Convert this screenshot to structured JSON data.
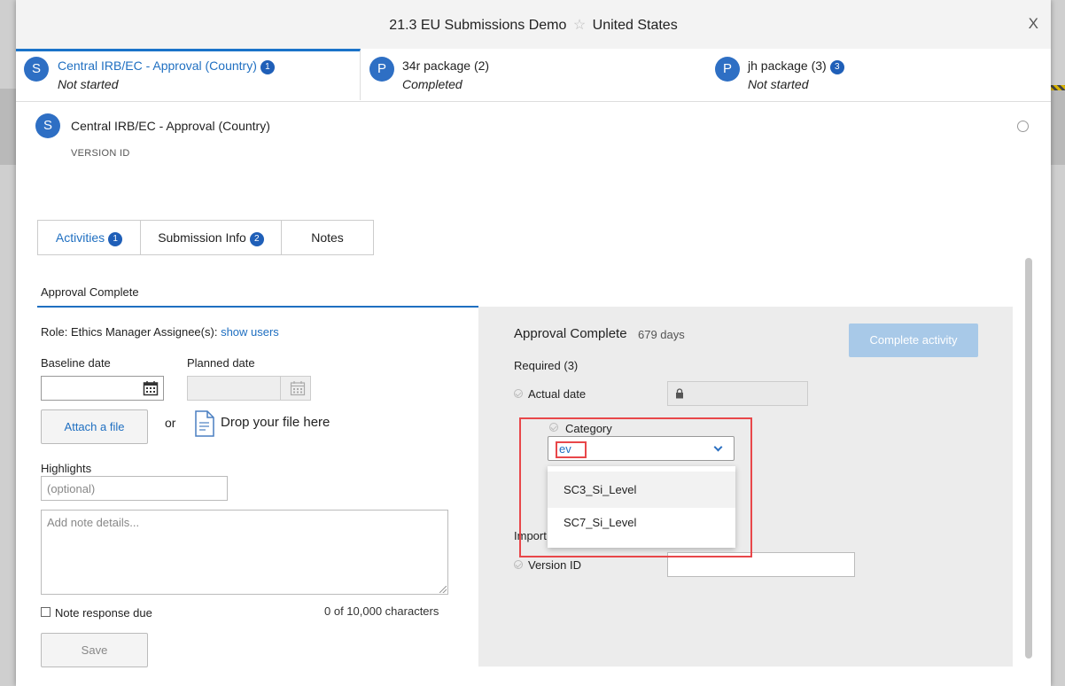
{
  "modal": {
    "title": "21.3 EU Submissions Demo",
    "country": "United States",
    "close_label": "X"
  },
  "package_tabs": [
    {
      "avatar": "S",
      "name": "Central IRB/EC - Approval (Country)",
      "badge": "1",
      "status": "Not started",
      "active": true
    },
    {
      "avatar": "P",
      "name": "34r package (2)",
      "badge": "",
      "status": "Completed",
      "active": false
    },
    {
      "avatar": "P",
      "name": "jh package (3)",
      "badge": "3",
      "status": "Not started",
      "active": false
    }
  ],
  "submission": {
    "avatar": "S",
    "title": "Central IRB/EC - Approval (Country)",
    "version_label": "VERSION ID"
  },
  "activity_tabs": [
    {
      "label": "Activities",
      "badge": "1",
      "active": true
    },
    {
      "label": "Submission Info",
      "badge": "2",
      "active": false
    },
    {
      "label": "Notes",
      "badge": "",
      "active": false
    }
  ],
  "step_tab": "Approval Complete",
  "left": {
    "role_text": "Role: Ethics Manager Assignee(s):",
    "show_users": "show users",
    "baseline_label": "Baseline date",
    "planned_label": "Planned date",
    "attach_label": "Attach a file",
    "or_text": "or",
    "drop_text": "Drop your file here",
    "highlights_label": "Highlights",
    "highlights_placeholder": "(optional)",
    "note_placeholder": "Add note details...",
    "response_due_label": "Note response due",
    "char_count": "0 of 10,000 characters",
    "save_label": "Save"
  },
  "right": {
    "title": "Approval Complete",
    "days": "679 days",
    "complete_label": "Complete activity",
    "required": "Required (3)",
    "actual_date_label": "Actual date",
    "category_label": "Category",
    "category_value": "ev",
    "options": [
      "SC3_Si_Level",
      "SC7_Si_Level"
    ],
    "import_partial": "Import",
    "version_id_label": "Version ID"
  },
  "colors": {
    "accent": "#1f6fc1",
    "avatar": "#2e6fc4",
    "highlight": "#e8474a",
    "complete_button": "#a8c9e8"
  }
}
